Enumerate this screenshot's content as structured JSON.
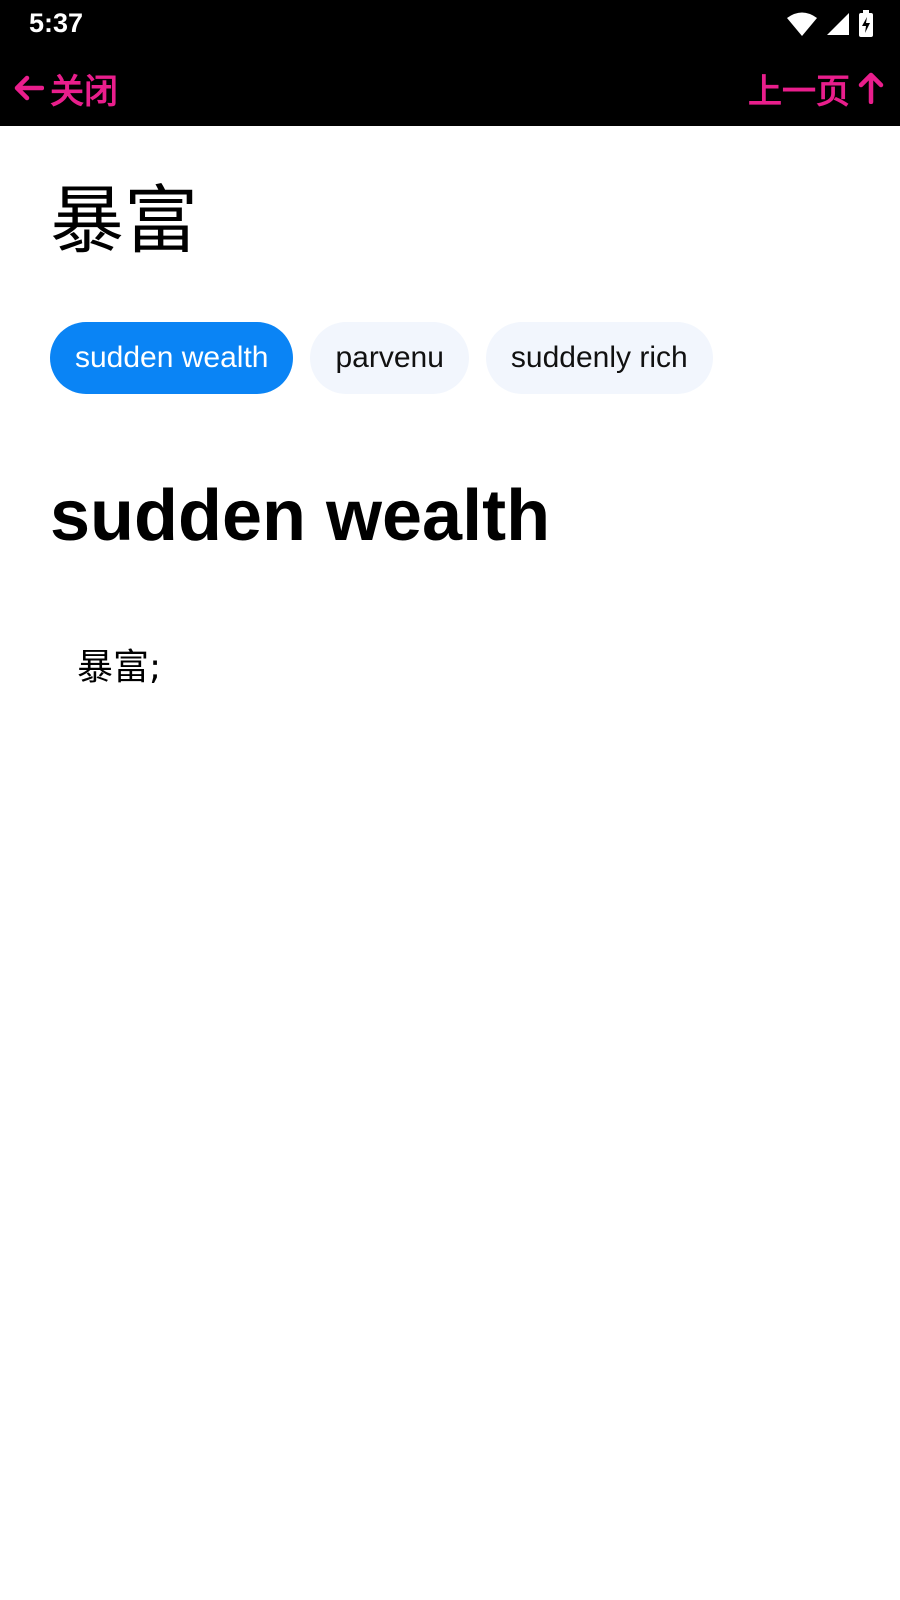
{
  "status_bar": {
    "time": "5:37",
    "icons": [
      "wifi-icon",
      "cell-signal-icon",
      "battery-charging-icon"
    ]
  },
  "top_bar": {
    "close_label": "关闭",
    "close_icon": "arrow-left-icon",
    "prev_label": "上一页",
    "prev_icon": "arrow-up-icon",
    "accent_color": "#e91e8c"
  },
  "entry": {
    "headword": "暴富",
    "chips": [
      {
        "label": "sudden wealth",
        "selected": true
      },
      {
        "label": "parvenu",
        "selected": false
      },
      {
        "label": "suddenly rich",
        "selected": false
      }
    ],
    "selected_sense": {
      "title": "sudden wealth",
      "definition": "暴富;"
    }
  },
  "colors": {
    "chip_active_bg": "#0a84f5",
    "chip_inactive_bg": "#f2f6fd",
    "bar_bg": "#000000",
    "page_bg": "#ffffff"
  }
}
